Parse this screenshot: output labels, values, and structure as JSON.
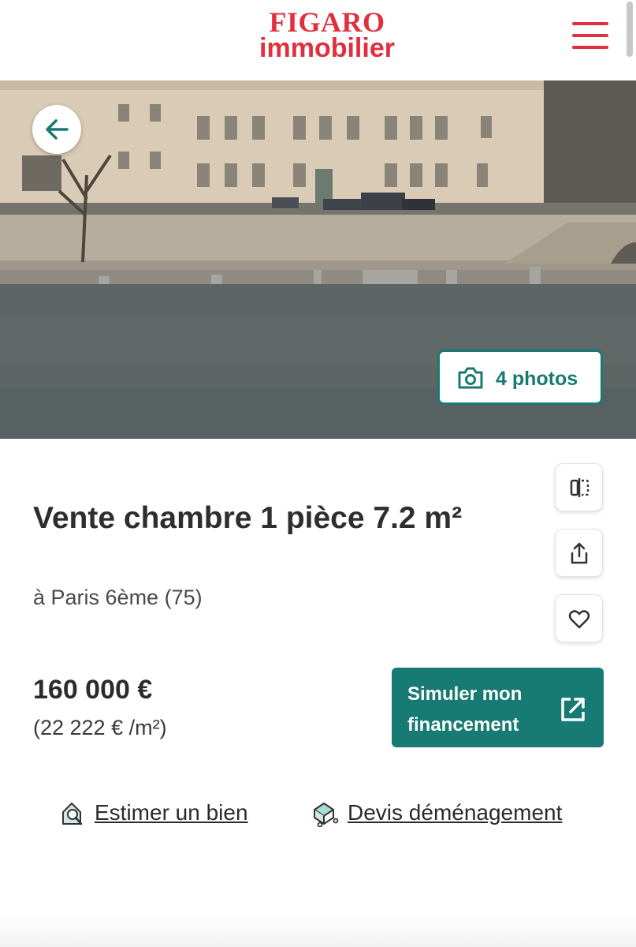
{
  "header": {
    "logo_line1": "FIGARO",
    "logo_line2": "immobilier",
    "brand_color": "#e0303f",
    "menu_icon": "hamburger-icon"
  },
  "hero": {
    "back_icon": "arrow-left-icon",
    "photos_icon": "camera-icon",
    "photos_label": "4 photos"
  },
  "actions": {
    "compare_icon": "compare-icon",
    "share_icon": "share-icon",
    "favorite_icon": "heart-icon"
  },
  "listing": {
    "title": "Vente chambre 1 pièce 7.2 m²",
    "location": "à Paris 6ème (75)",
    "price": "160 000 €",
    "price_per_sqm": "(22 222 € /m²)"
  },
  "finance": {
    "label": "Simuler mon financement",
    "icon": "external-link-icon",
    "accent_color": "#177a73"
  },
  "links": [
    {
      "label": "Estimer un bien",
      "icon": "house-search-icon"
    },
    {
      "label": "Devis déménagement",
      "icon": "moving-box-icon"
    }
  ]
}
